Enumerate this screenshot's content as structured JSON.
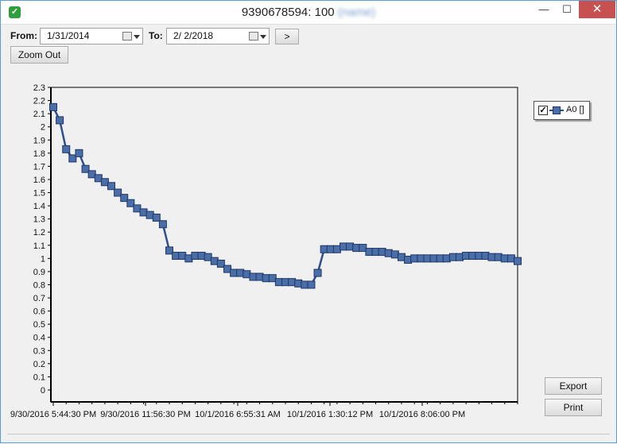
{
  "window": {
    "title": "9390678594: 100",
    "title_obscured": "(name)",
    "min_glyph": "—",
    "max_glyph": "☐",
    "close_glyph": "✕"
  },
  "toolbar": {
    "from_label": "From:",
    "from_value": "1/31/2014",
    "to_label": "To:",
    "to_value": "2/  2/2018",
    "go_label": ">",
    "zoom_out_label": "Zoom Out"
  },
  "side": {
    "export_label": "Export",
    "print_label": "Print"
  },
  "colors": {
    "series_line": "#2f4e8c",
    "series_marker": "#4a6ea8",
    "marker_stroke": "#1f3766",
    "plot_bg": "#f0f0f0"
  },
  "chart_data": {
    "type": "line",
    "title": "",
    "xlabel": "",
    "ylabel": "",
    "ylim": [
      0,
      2.3
    ],
    "yticks": [
      "0",
      "0.1",
      "0.2",
      "0.3",
      "0.4",
      "0.5",
      "0.6",
      "0.7",
      "0.8",
      "0.9",
      "1",
      "1.1",
      "1.2",
      "1.3",
      "1.4",
      "1.5",
      "1.6",
      "1.7",
      "1.8",
      "1.9",
      "2",
      "2.1",
      "2.2",
      "2.3"
    ],
    "xtick_labels": [
      "9/30/2016 5:44:30 PM",
      "9/30/2016 11:56:30 PM",
      "10/1/2016 6:55:31 AM",
      "10/1/2016 1:30:12 PM",
      "10/1/2016 8:06:00 PM"
    ],
    "grid": false,
    "legend_position": "right",
    "series": [
      {
        "name": "A0 []",
        "values": [
          2.15,
          2.05,
          1.83,
          1.76,
          1.8,
          1.68,
          1.64,
          1.61,
          1.58,
          1.55,
          1.5,
          1.46,
          1.42,
          1.38,
          1.35,
          1.33,
          1.31,
          1.26,
          1.06,
          1.02,
          1.02,
          1.0,
          1.02,
          1.02,
          1.01,
          0.98,
          0.96,
          0.92,
          0.89,
          0.89,
          0.88,
          0.86,
          0.86,
          0.85,
          0.85,
          0.82,
          0.82,
          0.82,
          0.81,
          0.8,
          0.8,
          0.89,
          1.07,
          1.07,
          1.07,
          1.09,
          1.09,
          1.08,
          1.08,
          1.05,
          1.05,
          1.05,
          1.04,
          1.03,
          1.01,
          0.99,
          1.0,
          1.0,
          1.0,
          1.0,
          1.0,
          1.0,
          1.01,
          1.01,
          1.02,
          1.02,
          1.02,
          1.02,
          1.01,
          1.01,
          1.0,
          1.0,
          0.98
        ]
      }
    ]
  }
}
